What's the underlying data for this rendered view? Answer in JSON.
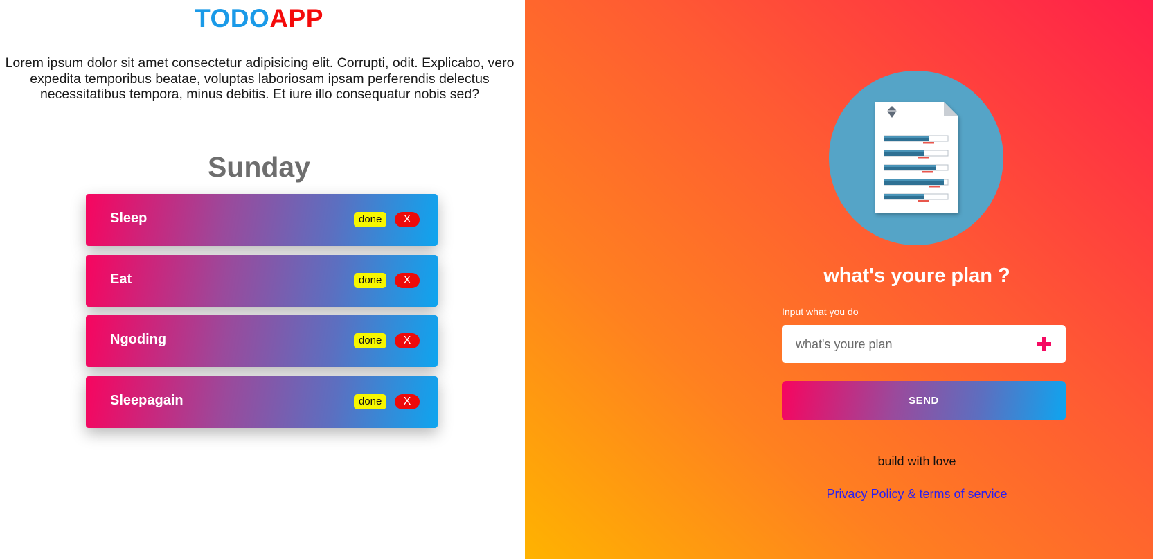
{
  "header": {
    "brand_part1": "TODO",
    "brand_part2": "APP",
    "intro": "Lorem ipsum dolor sit amet consectetur adipisicing elit. Corrupti, odit. Explicabo, vero expedita temporibus beatae, voluptas laboriosam ipsam perferendis delectus necessitatibus tempora, minus debitis. Et iure illo consequatur nobis sed?"
  },
  "todo": {
    "day": "Sunday",
    "done_label": "done",
    "delete_label": "X",
    "items": [
      {
        "title": "Sleep"
      },
      {
        "title": "Eat"
      },
      {
        "title": "Ngoding"
      },
      {
        "title": "Sleepagain"
      }
    ]
  },
  "form": {
    "title": "what's youre plan ?",
    "input_label": "Input what you do",
    "input_placeholder": "what's youre plan",
    "input_value": "",
    "send_label": "SEND",
    "add_icon": "plus-icon",
    "illustration_icon": "document-report-icon"
  },
  "footer": {
    "text": "build with love",
    "link": "Privacy Policy & terms of service"
  },
  "colors": {
    "brand_todo": "#1a9ae8",
    "brand_app": "#f40a0a",
    "gradient_start": "#f7055f",
    "gradient_end": "#0ea5ef",
    "done_button": "#f7f700",
    "delete_button": "#ee0a0a",
    "panel_gradient_start": "#ffb300",
    "panel_gradient_end": "#ff1f4a",
    "link": "#2a1ff0"
  }
}
